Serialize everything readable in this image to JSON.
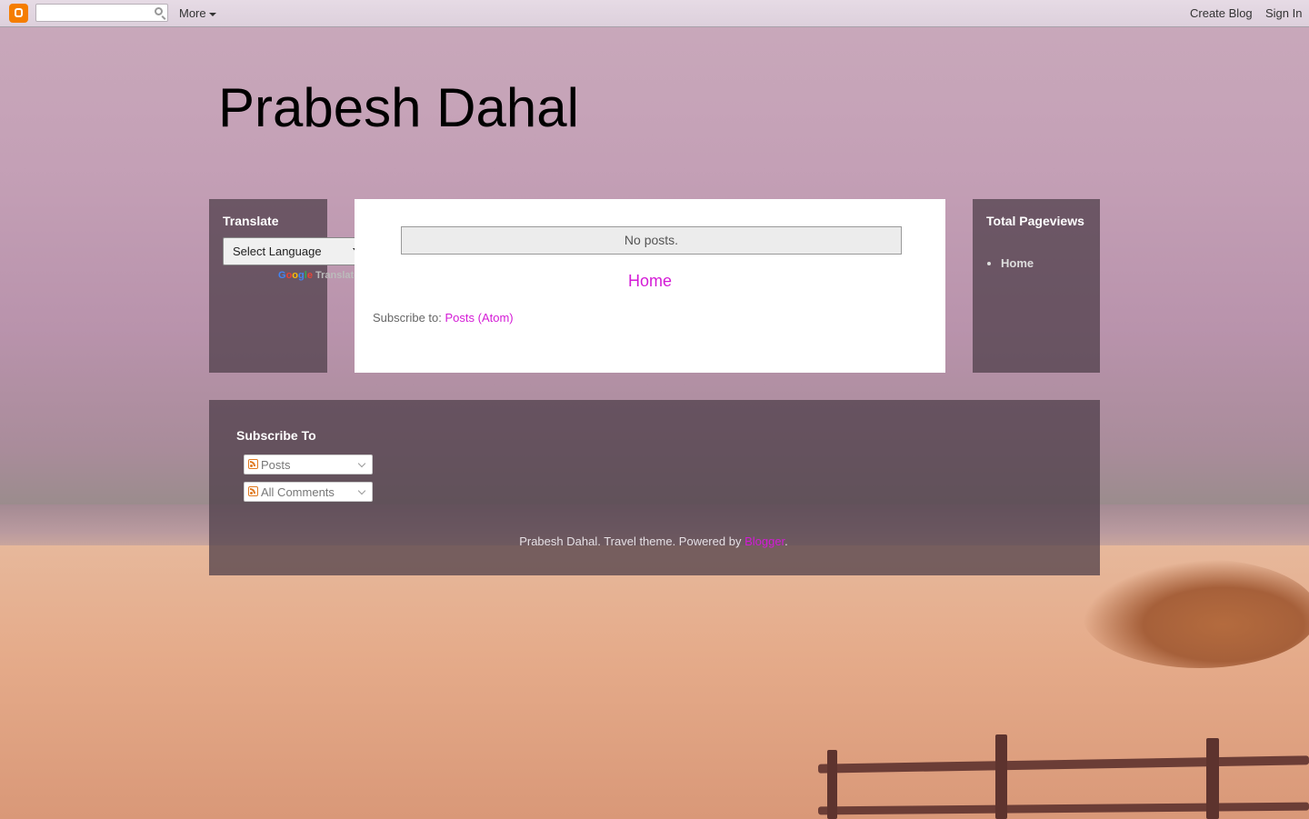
{
  "navbar": {
    "more_label": "More",
    "create_blog": "Create Blog",
    "sign_in": "Sign In",
    "search_value": ""
  },
  "blog": {
    "title": "Prabesh Dahal"
  },
  "left_sidebar": {
    "title": "Translate",
    "language_select": "Select Language",
    "powered_by_google": "Google",
    "powered_by_translate": "Translate"
  },
  "main": {
    "no_posts": "No posts.",
    "home_link": "Home",
    "subscribe_prefix": "Subscribe to:",
    "subscribe_link": "Posts (Atom)"
  },
  "right_sidebar": {
    "title": "Total Pageviews",
    "items": [
      "Home"
    ]
  },
  "footer": {
    "title": "Subscribe To",
    "posts_label": "Posts",
    "comments_label": "All Comments",
    "attribution_text": "Prabesh Dahal. Travel theme. Powered by",
    "attribution_link": "Blogger",
    "attribution_end": "."
  },
  "colors": {
    "accent": "#d41bd6",
    "blogger_orange": "#f57d00",
    "panel": "#4b3c46"
  }
}
